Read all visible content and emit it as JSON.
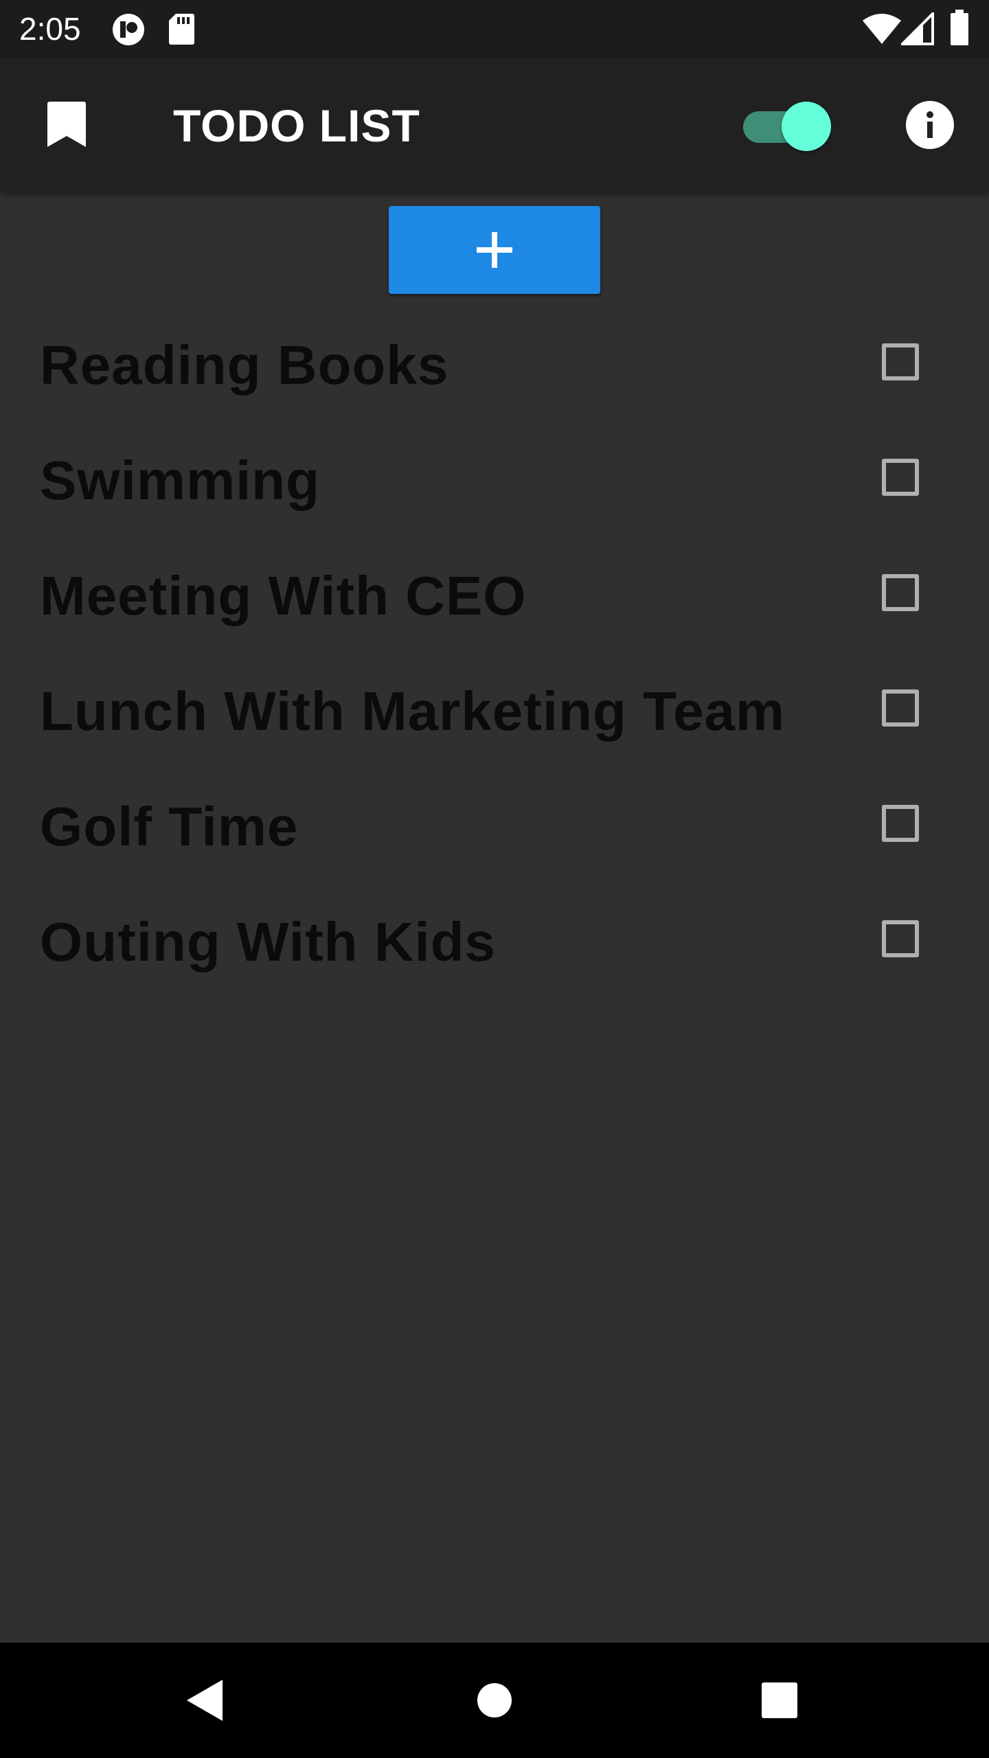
{
  "status_bar": {
    "time": "2:05",
    "icons": [
      "notification-app-icon",
      "sd-card-icon",
      "wifi-icon",
      "cell-signal-icon",
      "battery-icon"
    ]
  },
  "app_bar": {
    "title": "TODO LIST",
    "bookmark_icon": "bookmark-icon",
    "toggle_on": true,
    "info_icon": "info-icon"
  },
  "add_button": {
    "label": "+",
    "icon": "plus-icon"
  },
  "todos": [
    {
      "label": "Reading Books",
      "checked": false
    },
    {
      "label": "Swimming",
      "checked": false
    },
    {
      "label": "Meeting With CEO",
      "checked": false
    },
    {
      "label": "Lunch With Marketing Team",
      "checked": false
    },
    {
      "label": "Golf Time",
      "checked": false
    },
    {
      "label": "Outing With Kids",
      "checked": false
    }
  ],
  "nav_bar": {
    "icons": [
      "back-icon",
      "home-icon",
      "recents-icon"
    ]
  },
  "colors": {
    "background": "#303030",
    "status_bar": "#1c1c1c",
    "app_bar": "#212121",
    "accent_button": "#1e88e5",
    "toggle_track": "#3f8f78",
    "toggle_thumb": "#64ffda",
    "todo_text": "#0b0b0b",
    "checkbox_border": "#b0b0b0"
  }
}
